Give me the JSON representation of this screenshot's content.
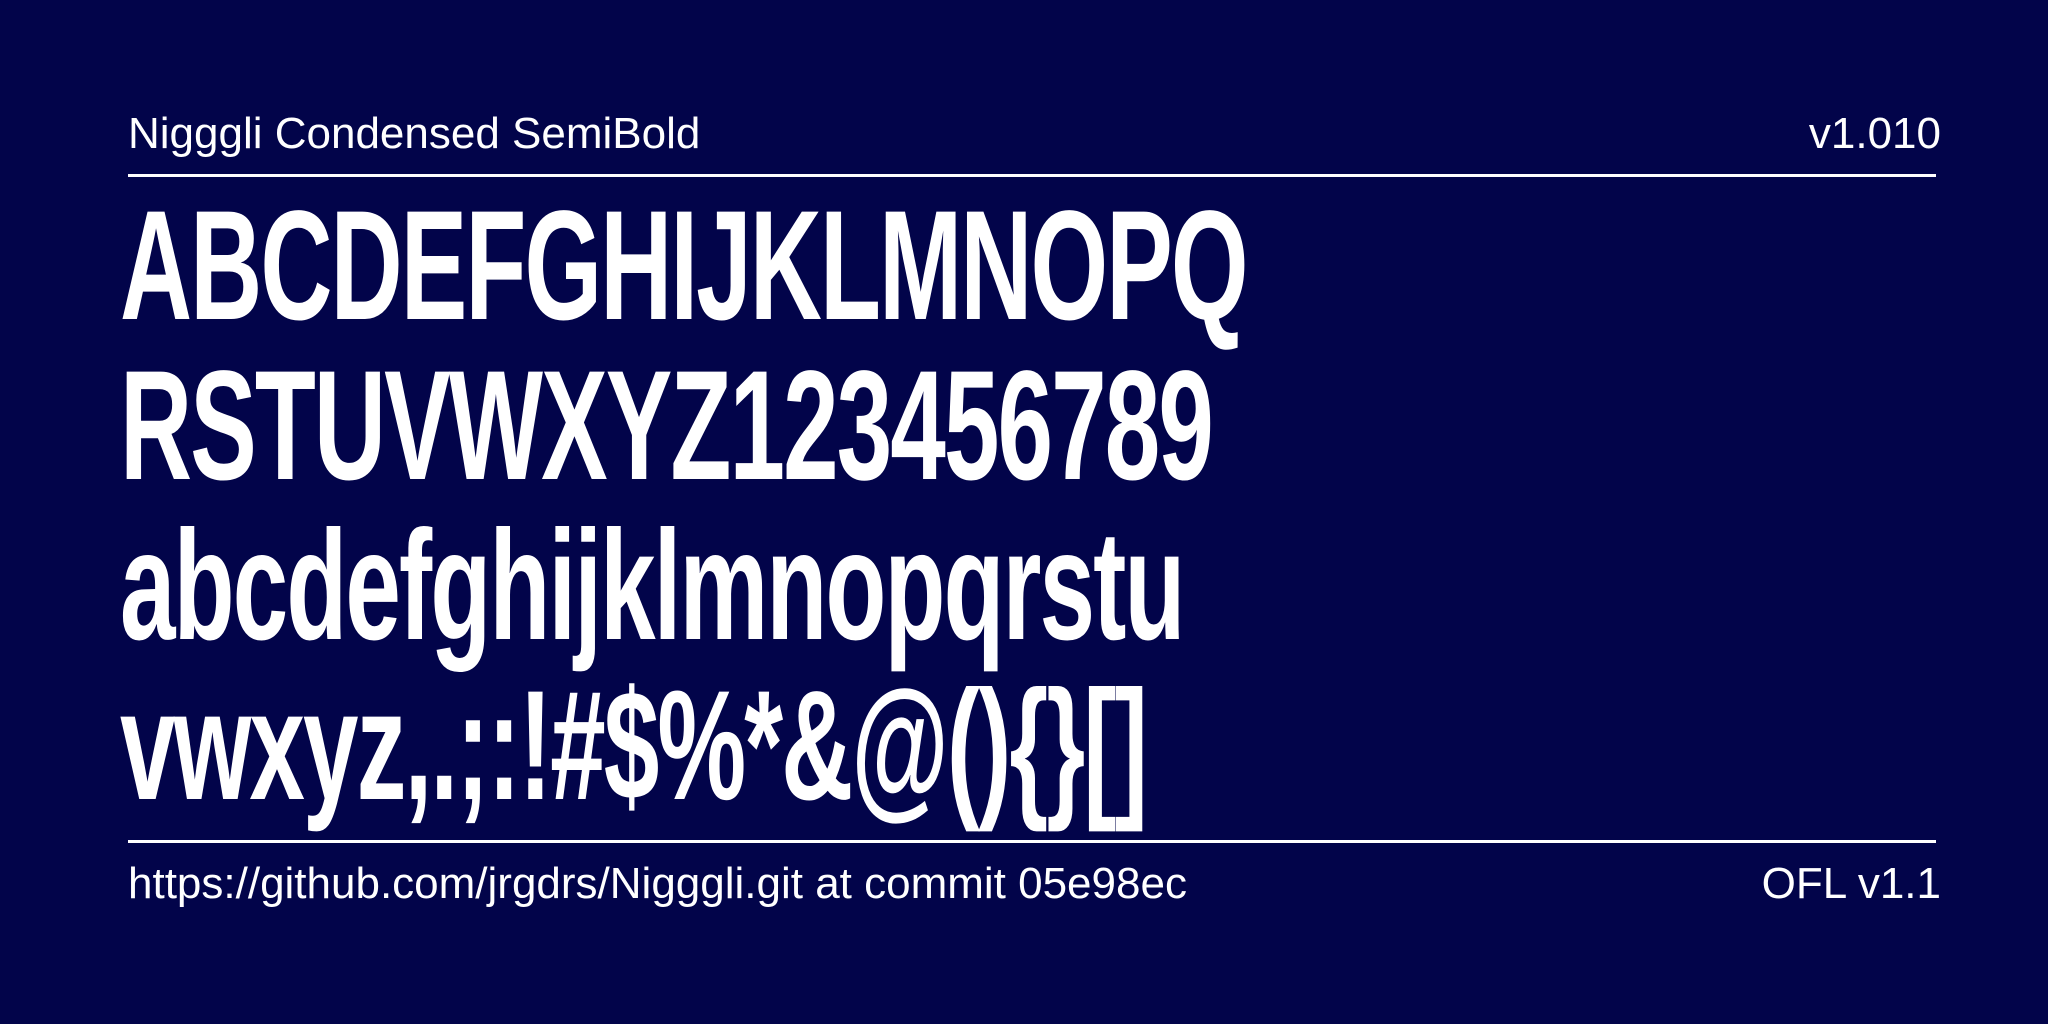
{
  "header": {
    "font_name": "Nigggli Condensed SemiBold",
    "version": "v1.010"
  },
  "specimen": {
    "lines": [
      "ABCDEFGHIJKLMNOPQ",
      "RSTUVWXYZ123456789",
      "abcdefghijklmnopqrstu",
      "vwxyz,.;:!#$%*&@(){}[]"
    ]
  },
  "footer": {
    "source": "https://github.com/jrgdrs/Nigggli.git at commit 05e98ec",
    "license": "OFL v1.1"
  },
  "colors": {
    "background": "#02044a",
    "foreground": "#ffffff"
  }
}
